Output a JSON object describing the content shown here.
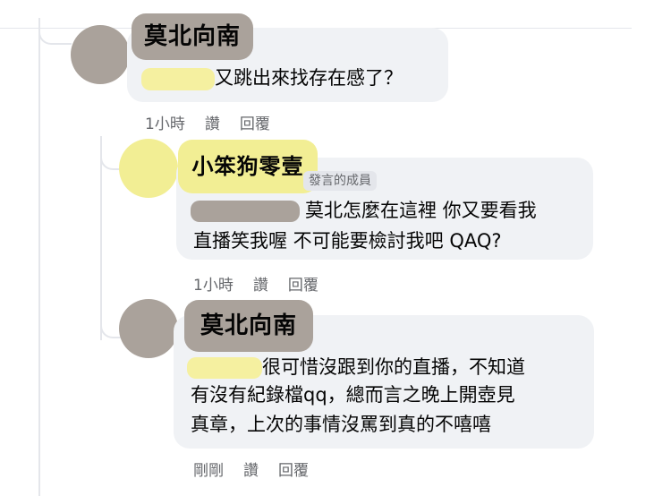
{
  "colors": {
    "avatar_gray": "#aaa29b",
    "avatar_yellow": "#f2ee94",
    "redact_yellow": "#f5f0a0",
    "redact_gray": "#aaa29b",
    "bubble": "#f0f2f5",
    "meta_text": "#65676b"
  },
  "comments": [
    {
      "author": "莫北向南",
      "text": "又跳出來找存在感了？",
      "time": "1小時",
      "like": "讚",
      "reply": "回覆"
    },
    {
      "author": "小笨狗零壹",
      "badge": "發言的成員",
      "line1": "莫北怎麼在這裡 你又要看我",
      "line2": "直播笑我喔 不可能要檢討我吧 QAQ?",
      "time": "1小時",
      "like": "讚",
      "reply": "回覆"
    },
    {
      "author": "莫北向南",
      "line1": "很可惜沒跟到你的直播，不知道",
      "line2": "有沒有紀錄檔qq，總而言之晚上開壺見",
      "line3": "真章，上次的事情沒罵到真的不嘻嘻",
      "time": "剛剛",
      "like": "讚",
      "reply": "回覆"
    }
  ]
}
